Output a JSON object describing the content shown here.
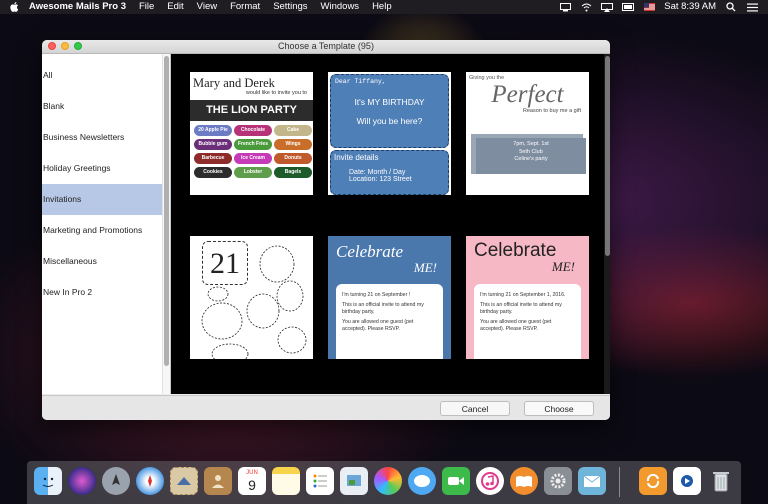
{
  "menubar": {
    "app_name": "Awesome Mails Pro 3",
    "items": [
      "File",
      "Edit",
      "View",
      "Format",
      "Settings",
      "Windows",
      "Help"
    ],
    "clock": "Sat 8:39 AM"
  },
  "window": {
    "title": "Choose a Template (95)",
    "categories": [
      "All",
      "Blank",
      "Business Newsletters",
      "Holiday Greetings",
      "Invitations",
      "Marketing and Promotions",
      "Miscellaneous",
      "New In Pro 2"
    ],
    "selected_category_index": 4,
    "buttons": {
      "cancel": "Cancel",
      "choose": "Choose"
    }
  },
  "templates": {
    "t1": {
      "title": "Mary and Derek",
      "sub": "would like to invite you to",
      "band": "THE LION PARTY",
      "pills": [
        "20 Apple Pie",
        "Chocolate",
        "Cake",
        "Bubble gum",
        "French Fries",
        "Wings",
        "Barbecue",
        "Ice Cream",
        "Donuts",
        "Cookies",
        "Lobster",
        "Bagels"
      ],
      "colors": [
        "#6b7bc4",
        "#b6337a",
        "#c2b68a",
        "#6b2f79",
        "#4a9a3c",
        "#c86e2a",
        "#8e2b2b",
        "#c43ab7",
        "#c0592c",
        "#2c2c2c",
        "#5e9e4a",
        "#1d5b2a"
      ]
    },
    "t2": {
      "greeting": "Dear Tiffany,",
      "line1": "It's MY BIRTHDAY",
      "line2": "Will you be here?",
      "details_title": "Invite details",
      "date": "Date: Month / Day",
      "location": "Location: 123 Street"
    },
    "t3": {
      "pre": "Giving you the",
      "word": "Perfect",
      "reason": "Reason to buy me a gift",
      "time": "7pm, Sept. 1st",
      "club": "5eth Club",
      "party": "Celine's party"
    },
    "t4": {
      "big": "21"
    },
    "t5": {
      "heading1": "Celebrate",
      "heading2": "ME!",
      "l1": "I'm turning 21 on September !",
      "l2": "This is an official invite to attend my birthday party.",
      "l3": "You are allowed one guest (pet accepted). Please RSVP."
    },
    "t6": {
      "heading1": "Celebrate",
      "heading2": "ME!",
      "l1": "I'm turning 21 on September 1, 2016.",
      "l2": "This is an official invite to attend my birthday party.",
      "l3": "You are allowed one guest (pet accepted). Please RSVP."
    }
  },
  "dock": {
    "calendar_month": "JUN",
    "calendar_day": "9",
    "icons": [
      "finder-icon",
      "siri-icon",
      "launchpad-icon",
      "safari-icon",
      "mail-stamp-icon",
      "contacts-icon",
      "calendar-icon",
      "notes-icon",
      "reminders-icon",
      "preview-icon",
      "photos-icon",
      "messages-icon",
      "facetime-icon",
      "itunes-icon",
      "ibooks-icon",
      "system-preferences-icon",
      "awesome-mails-icon",
      "sync-icon",
      "quicktime-icon",
      "trash-icon"
    ]
  }
}
